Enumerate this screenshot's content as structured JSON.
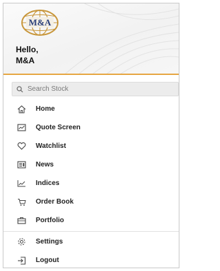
{
  "brand": {
    "logo_text": "M&A",
    "accent_color": "#e6a642",
    "globe_color": "#c8963a"
  },
  "header": {
    "greeting": "Hello,",
    "username": "M&A"
  },
  "search": {
    "placeholder": "Search Stock",
    "icon": "search-icon"
  },
  "menu": {
    "items": [
      {
        "label": "Home",
        "icon": "home-icon"
      },
      {
        "label": "Quote Screen",
        "icon": "chart-window-icon"
      },
      {
        "label": "Watchlist",
        "icon": "heart-icon"
      },
      {
        "label": "News",
        "icon": "news-icon"
      },
      {
        "label": "Indices",
        "icon": "line-chart-icon"
      },
      {
        "label": "Order Book",
        "icon": "cart-icon"
      },
      {
        "label": "Portfolio",
        "icon": "briefcase-icon"
      }
    ],
    "secondary": [
      {
        "label": "Settings",
        "icon": "gear-icon"
      },
      {
        "label": "Logout",
        "icon": "logout-icon"
      }
    ]
  }
}
